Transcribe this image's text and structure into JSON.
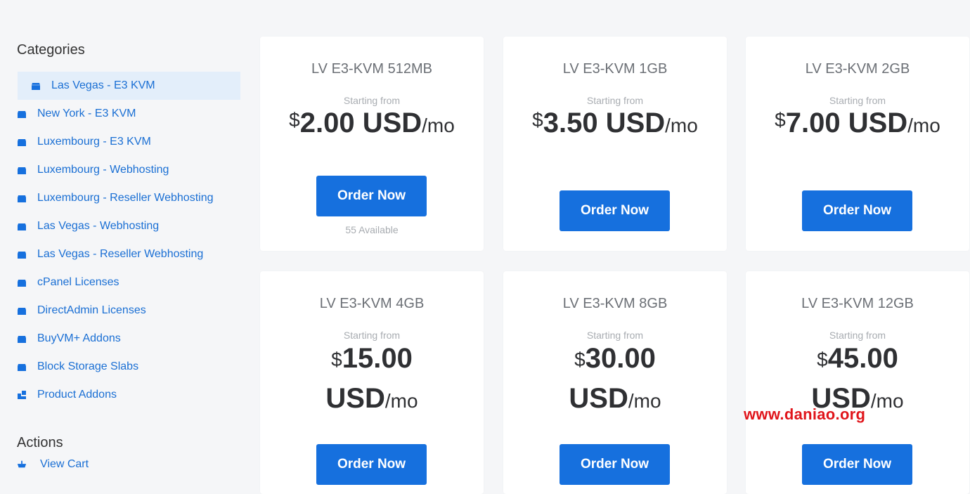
{
  "sidebar": {
    "categories_title": "Categories",
    "categories": [
      {
        "label": "Las Vegas - E3 KVM",
        "icon": "box-icon",
        "active": true
      },
      {
        "label": "New York - E3 KVM",
        "icon": "box-icon"
      },
      {
        "label": "Luxembourg - E3 KVM",
        "icon": "box-icon"
      },
      {
        "label": "Luxembourg - Webhosting",
        "icon": "box-icon"
      },
      {
        "label": "Luxembourg - Reseller Webhosting",
        "icon": "box-icon"
      },
      {
        "label": "Las Vegas - Webhosting",
        "icon": "box-icon"
      },
      {
        "label": "Las Vegas - Reseller Webhosting",
        "icon": "box-icon"
      },
      {
        "label": "cPanel Licenses",
        "icon": "box-icon"
      },
      {
        "label": "DirectAdmin Licenses",
        "icon": "box-icon"
      },
      {
        "label": "BuyVM+ Addons",
        "icon": "box-icon"
      },
      {
        "label": "Block Storage Slabs",
        "icon": "box-icon"
      },
      {
        "label": "Product Addons",
        "icon": "cubes-icon"
      }
    ],
    "actions_title": "Actions",
    "actions": [
      {
        "label": "View Cart",
        "icon": "cart-icon"
      }
    ]
  },
  "products": [
    {
      "name": "LV E3-KVM 512MB",
      "starting": "Starting from",
      "currency": "$",
      "amount": "2.00 USD",
      "period": "/mo",
      "button": "Order Now",
      "available": "55 Available"
    },
    {
      "name": "LV E3-KVM 1GB",
      "starting": "Starting from",
      "currency": "$",
      "amount": "3.50 USD",
      "period": "/mo",
      "button": "Order Now"
    },
    {
      "name": "LV E3-KVM 2GB",
      "starting": "Starting from",
      "currency": "$",
      "amount": "7.00 USD",
      "period": "/mo",
      "button": "Order Now"
    },
    {
      "name": "LV E3-KVM 4GB",
      "starting": "Starting from",
      "currency": "$",
      "amount": "15.00",
      "amount2": "USD",
      "period": "/mo",
      "button": "Order Now"
    },
    {
      "name": "LV E3-KVM 8GB",
      "starting": "Starting from",
      "currency": "$",
      "amount": "30.00",
      "amount2": "USD",
      "period": "/mo",
      "button": "Order Now"
    },
    {
      "name": "LV E3-KVM 12GB",
      "starting": "Starting from",
      "currency": "$",
      "amount": "45.00",
      "amount2": "USD",
      "period": "/mo",
      "button": "Order Now"
    }
  ],
  "watermark": "www.daniao.org",
  "colors": {
    "accent": "#1670de",
    "link": "#1a6fd4",
    "active_bg": "#e3eefa",
    "watermark": "#e0151b"
  }
}
